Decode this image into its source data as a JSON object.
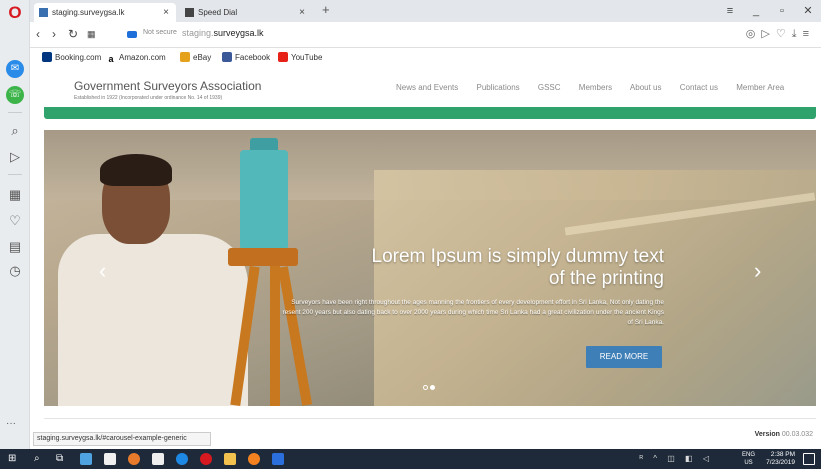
{
  "browser": {
    "tabs": [
      {
        "title": "staging.surveygsa.lk",
        "active": true
      },
      {
        "title": "Speed Dial",
        "active": false
      }
    ],
    "new_tab": "+",
    "close_glyph": "×",
    "not_secure": "Not secure",
    "url_prefix": "staging.",
    "url_domain": "surveygsa.lk",
    "bookmarks": [
      "Booking.com",
      "Amazon.com",
      "eBay",
      "Facebook",
      "YouTube"
    ],
    "status_url": "staging.surveygsa.lk/#carousel-example-generic"
  },
  "site": {
    "title": "Government Surveyors Association",
    "subtitle": "Established in 1922 (Incorporated under ordinance No. 14 of 1939)",
    "nav": [
      "News and Events",
      "Publications",
      "GSSC",
      "Members",
      "About us",
      "Contact us",
      "Member Area"
    ],
    "accent_color": "#2fa36b"
  },
  "carousel": {
    "title_line1": "Lorem Ipsum is simply dummy text",
    "title_line2": "of the printing",
    "description_line1": "Surveyors have been right throughout the ages manning the frontiers of every development effort in Sri Lanka, Not only dating the",
    "description_line2": "resent 200 years but also dating back to over 2000 years during which time Sri Lanka had a great civilization under the ancient Kings",
    "description_line3": "of Sri Lanka.",
    "button": "READ MORE",
    "prev": "‹",
    "next": "›",
    "slides": 2,
    "active_slide": 2
  },
  "footer": {
    "version_label": "Version",
    "version_number": "00.03.032"
  },
  "taskbar": {
    "lang_line1": "ENG",
    "lang_line2": "US",
    "time": "2:38 PM",
    "date": "7/23/2019"
  }
}
